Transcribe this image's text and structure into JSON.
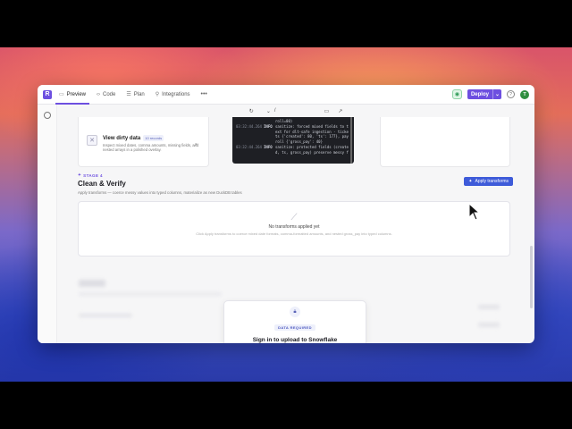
{
  "topbar": {
    "logo": "R",
    "tabs": [
      {
        "label": "Preview",
        "icon": "▭"
      },
      {
        "label": "Code",
        "icon": "‹›"
      },
      {
        "label": "Plan",
        "icon": "☰"
      },
      {
        "label": "Integrations",
        "icon": "⚲"
      }
    ],
    "more": "•••",
    "deploy_label": "Deploy",
    "deploy_caret": "⌄",
    "help": "?",
    "avatar": "T"
  },
  "toolbar2": {
    "reload_icon": "↻",
    "path_caret": "⌄",
    "path": "/",
    "screen_icon": "▭",
    "open_icon": "↗"
  },
  "dirty_card": {
    "title": "View dirty data",
    "badge": "10 records",
    "description": "Inspect mixed dates, comma amounts, missing fields, and nested arrays in a polished overlay.",
    "ext_icon": "↗"
  },
  "console": {
    "lines": [
      {
        "ts": "",
        "lvl": "",
        "msg": "roll=00)"
      },
      {
        "ts": "03:32:44.264",
        "lvl": "INFO",
        "msg": "sanitize: forced mixed fields to t"
      },
      {
        "ts": "",
        "lvl": "",
        "msg": "ext for dlt-safe ingestion · ticke"
      },
      {
        "ts": "",
        "lvl": "",
        "msg": "ts {'created': 80, 'ts': 177}, pay"
      },
      {
        "ts": "",
        "lvl": "",
        "msg": "roll {'gross_pay': 40}"
      },
      {
        "ts": "03:32:44.264",
        "lvl": "INFO",
        "msg": "sanitize: protected fields (create"
      },
      {
        "ts": "",
        "lvl": "",
        "msg": "d, ts, gross_pay) preserve messy f"
      }
    ]
  },
  "stage": {
    "label": "STAGE 4",
    "title": "Clean & Verify",
    "subtitle": "Apply transforms — coerce messy values into typed columns, materialize as new DuckDB tables",
    "apply_button": "Apply transforms"
  },
  "empty_state": {
    "title": "No transforms applied yet",
    "description": "Click Apply transforms to coerce mixed date formats, comma-formatted amounts, and nested gross_pay into typed columns."
  },
  "signin": {
    "badge": "DATA REQUIRED",
    "title": "Sign in to upload to Snowflake"
  }
}
